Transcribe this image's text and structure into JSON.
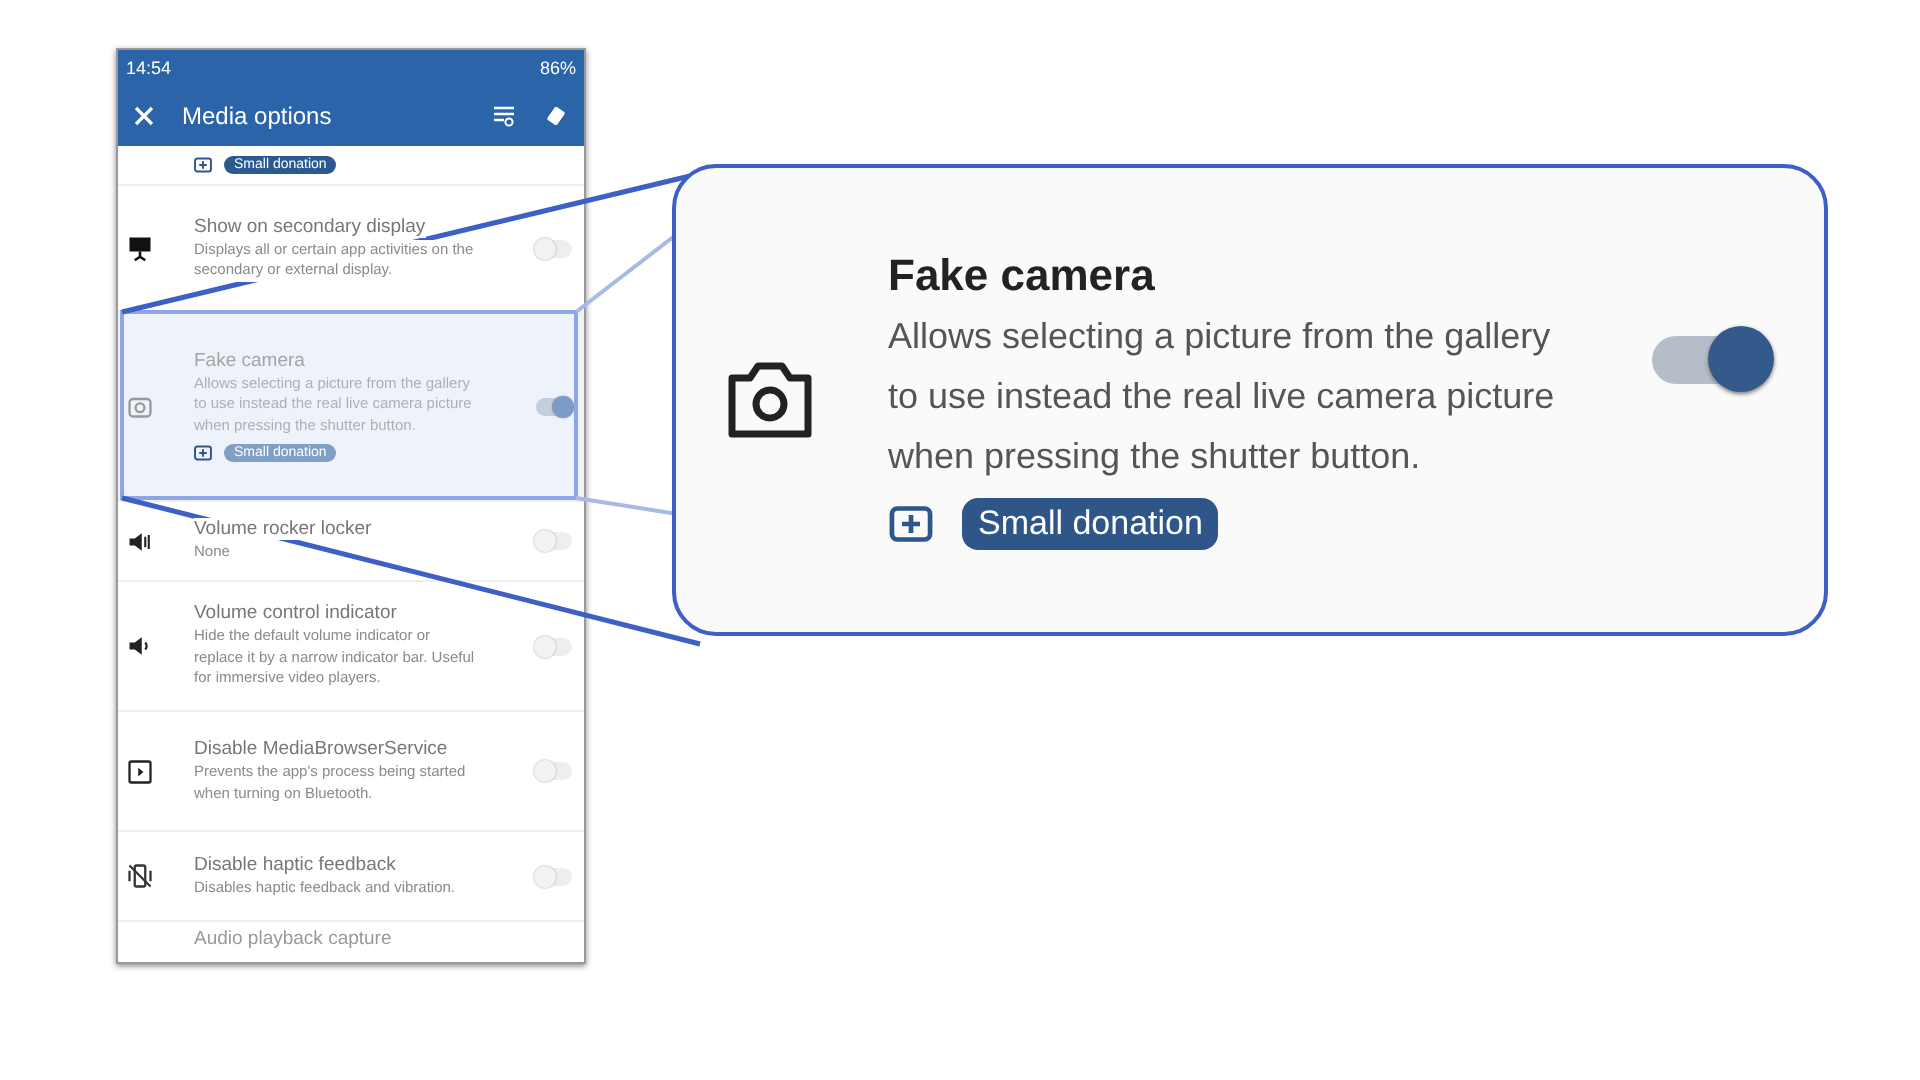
{
  "phone": {
    "status_bar": {
      "time": "14:54",
      "battery": "86%"
    },
    "app_bar": {
      "title": "Media options"
    },
    "items": [
      {
        "kind": "tag_row",
        "tag": "Small donation"
      },
      {
        "kind": "setting",
        "title": "Show on secondary display",
        "description": "Displays all or certain app activities on the secondary or external display.",
        "on": false,
        "highlighted": false
      },
      {
        "kind": "setting",
        "title": "Fake camera",
        "description": "Allows selecting a picture from the gallery to use instead the real live camera picture when pressing the shutter button.",
        "on": true,
        "tag": "Small donation",
        "highlighted": true
      },
      {
        "kind": "setting",
        "title": "Volume rocker locker",
        "description": "None",
        "on": false,
        "highlighted": false
      },
      {
        "kind": "setting",
        "title": "Volume control indicator",
        "description": "Hide the default volume indicator or replace it by a narrow indicator bar. Useful for immersive video players.",
        "on": false,
        "highlighted": false
      },
      {
        "kind": "setting",
        "title": "Disable MediaBrowserService",
        "description": "Prevents the app's process being started when turning on Bluetooth.",
        "on": false,
        "highlighted": false
      },
      {
        "kind": "setting",
        "title": "Disable haptic feedback",
        "description": "Disables haptic feedback and vibration.",
        "on": false,
        "highlighted": false
      },
      {
        "kind": "cut_title",
        "title": "Audio playback capture"
      }
    ]
  },
  "callout": {
    "title": "Fake camera",
    "description": "Allows selecting a picture from the gallery to use instead the real live camera picture when pressing the shutter button.",
    "on": true,
    "tag": "Small donation"
  }
}
